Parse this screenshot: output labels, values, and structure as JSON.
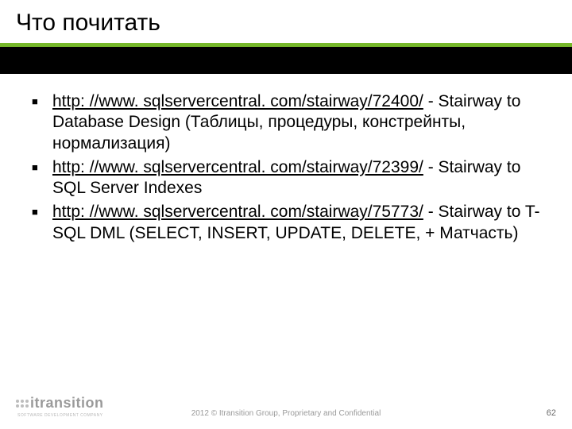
{
  "title": "Что почитать",
  "bullets": [
    {
      "link": "http: //www. sqlservercentral. com/stairway/72400/",
      "after": " - Stairway to Database Design (Таблицы, процедуры, констрейнты, нормализация)"
    },
    {
      "link": "http: //www. sqlservercentral. com/stairway/72399/",
      "after": " - Stairway to SQL Server Indexes"
    },
    {
      "link": "http: //www. sqlservercentral. com/stairway/75773/",
      "after": " - Stairway to T-SQL DML (SELECT, INSERT, UPDATE, DELETE, + Матчасть)"
    }
  ],
  "footer": {
    "logo_text": "itransition",
    "logo_sub": "SOFTWARE DEVELOPMENT COMPANY",
    "copyright": "2012 © Itransition Group, Proprietary and Confidential",
    "page": "62"
  }
}
